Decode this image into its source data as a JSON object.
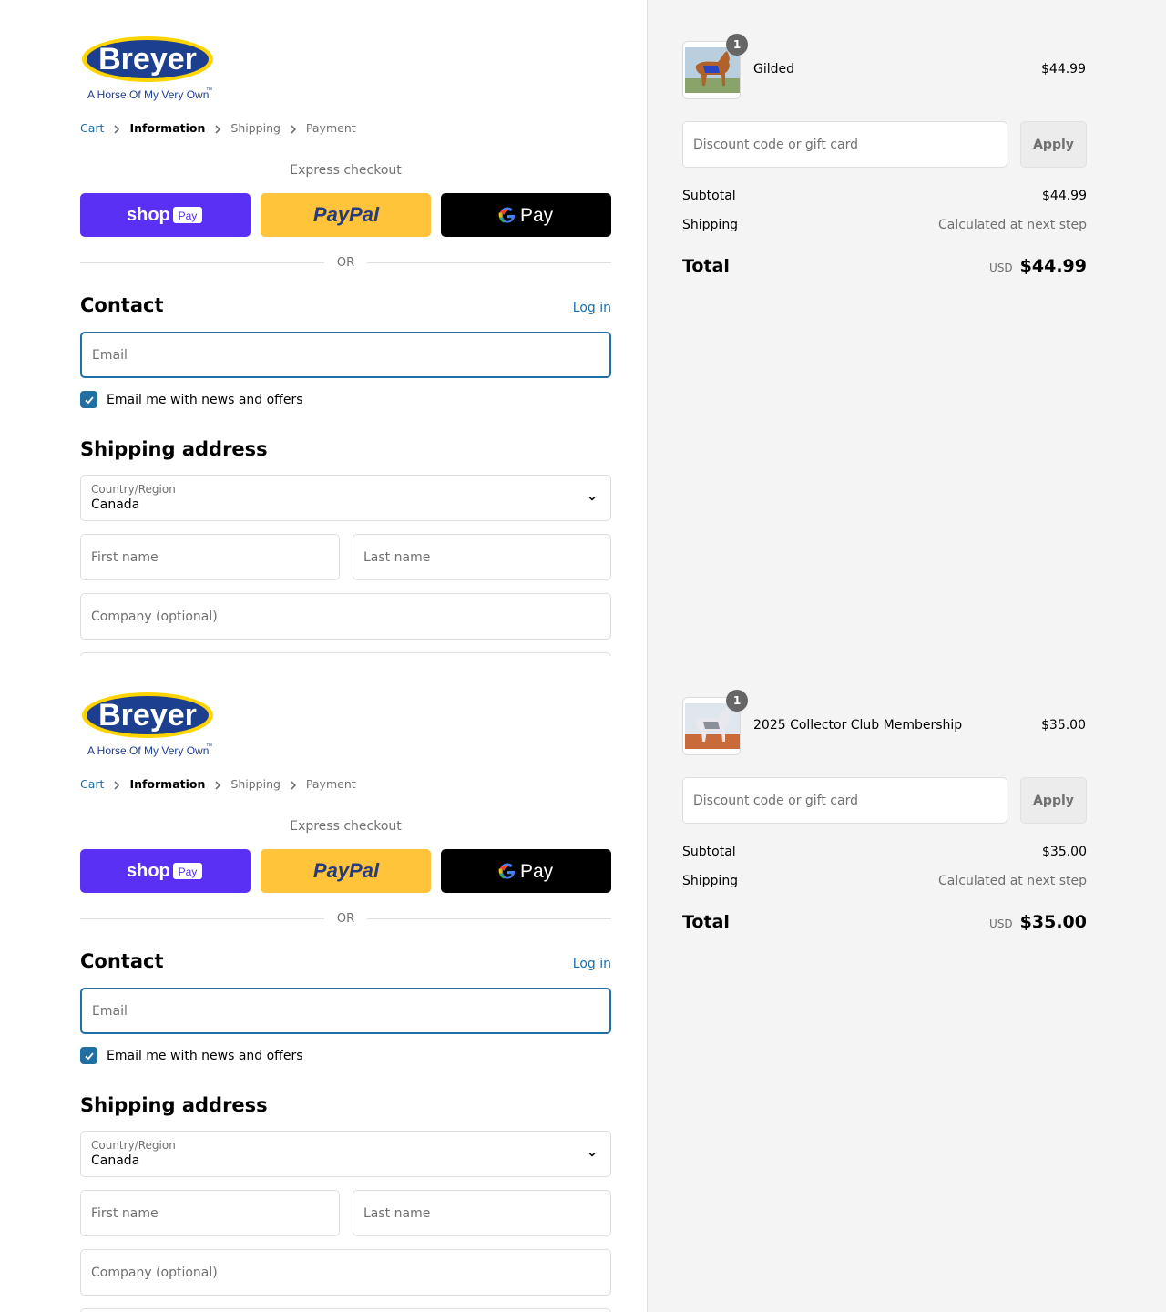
{
  "panels": [
    {
      "logo": {
        "wordmark": "Breyer",
        "tagline": "A Horse Of My Very Own",
        "tm": "™"
      },
      "breadcrumb": {
        "cart": "Cart",
        "information": "Information",
        "shipping": "Shipping",
        "payment": "Payment"
      },
      "express": {
        "title": "Express checkout",
        "shop_label": "shop",
        "shop_pay_tag": "Pay",
        "paypal_label": "PayPal",
        "gpay_label": "Pay"
      },
      "divider": "OR",
      "contact": {
        "title": "Contact",
        "login": "Log in",
        "email_placeholder": "Email",
        "newsletter_label": "Email me with news and offers",
        "newsletter_checked": true
      },
      "shipping": {
        "title": "Shipping address",
        "country_label": "Country/Region",
        "country_value": "Canada",
        "first_name_placeholder": "First name",
        "last_name_placeholder": "Last name",
        "company_placeholder": "Company (optional)"
      },
      "summary": {
        "item": {
          "name": "Gilded",
          "price": "$44.99",
          "quantity": "1"
        },
        "discount_placeholder": "Discount code or gift card",
        "apply": "Apply",
        "subtotal_label": "Subtotal",
        "subtotal": "$44.99",
        "shipping_label": "Shipping",
        "shipping_value": "Calculated at next step",
        "total_label": "Total",
        "currency": "USD",
        "total": "$44.99"
      }
    },
    {
      "logo": {
        "wordmark": "Breyer",
        "tagline": "A Horse Of My Very Own",
        "tm": "™"
      },
      "breadcrumb": {
        "cart": "Cart",
        "information": "Information",
        "shipping": "Shipping",
        "payment": "Payment"
      },
      "express": {
        "title": "Express checkout",
        "shop_label": "shop",
        "shop_pay_tag": "Pay",
        "paypal_label": "PayPal",
        "gpay_label": "Pay"
      },
      "divider": "OR",
      "contact": {
        "title": "Contact",
        "login": "Log in",
        "email_placeholder": "Email",
        "newsletter_label": "Email me with news and offers",
        "newsletter_checked": true
      },
      "shipping": {
        "title": "Shipping address",
        "country_label": "Country/Region",
        "country_value": "Canada",
        "first_name_placeholder": "First name",
        "last_name_placeholder": "Last name",
        "company_placeholder": "Company (optional)"
      },
      "summary": {
        "item": {
          "name": "2025 Collector Club Membership",
          "price": "$35.00",
          "quantity": "1"
        },
        "discount_placeholder": "Discount code or gift card",
        "apply": "Apply",
        "subtotal_label": "Subtotal",
        "subtotal": "$35.00",
        "shipping_label": "Shipping",
        "shipping_value": "Calculated at next step",
        "total_label": "Total",
        "currency": "USD",
        "total": "$35.00"
      }
    }
  ],
  "colors": {
    "accent": "#1f6fa3",
    "shop_pay": "#5a31f4",
    "paypal": "#ffc439",
    "gpay": "#000000",
    "logo_blue": "#1d3f8f",
    "logo_yellow": "#ffd400"
  },
  "icons": {
    "breadcrumb_sep": "chevron-right-icon",
    "select": "chevron-down-icon",
    "checkbox": "checkmark-icon",
    "gpay": "google-g-icon"
  }
}
